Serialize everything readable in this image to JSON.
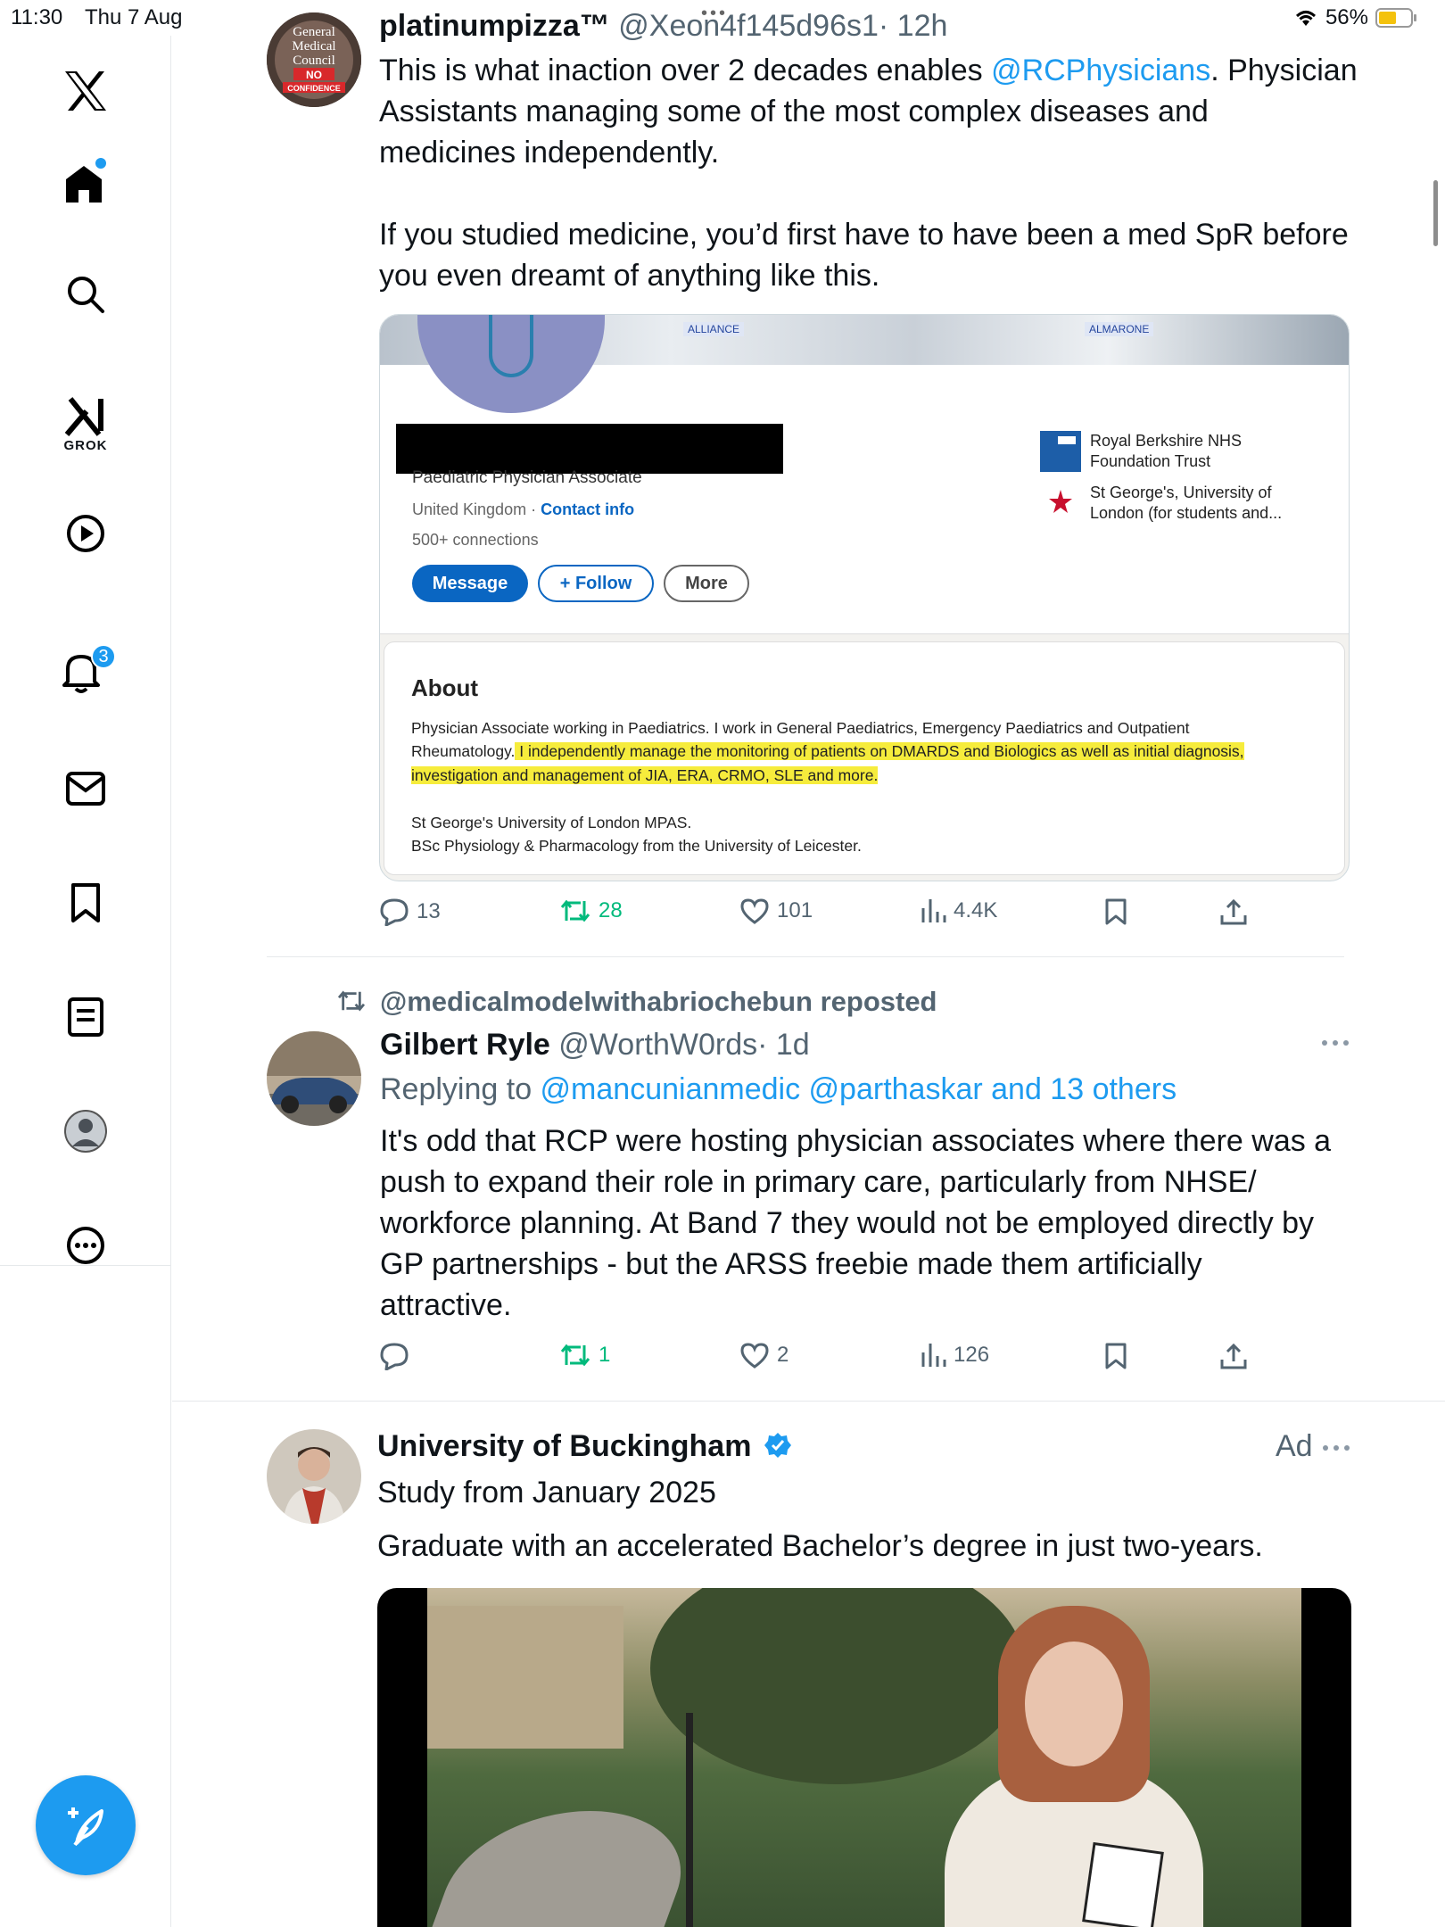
{
  "status_bar": {
    "time": "11:30",
    "date": "Thu 7 Aug",
    "battery_percent": "56%",
    "battery_level": 0.56
  },
  "sidebar": {
    "grok_label": "GROK",
    "notifications_badge": "3",
    "items": [
      "x-logo",
      "home",
      "search",
      "grok",
      "video",
      "notifications",
      "messages",
      "bookmarks",
      "lists",
      "profile",
      "more"
    ]
  },
  "tweet1": {
    "display_name": "platinumpizza™",
    "handle": "@Xeon4f145d96s1",
    "time": "· 12h",
    "text_part1": "This is what inaction over 2 decades enables ",
    "mention": "@RCPhysicians",
    "text_part2": ". Physician",
    "line2": "Assistants managing some of the most complex diseases and",
    "line3": "medicines independently.",
    "line4": "If you studied medicine, you’d first have to have been a med SpR before",
    "line5": "you even dreamt of anything like this.",
    "avatar_text": [
      "General",
      "Medical",
      "Council",
      "NO",
      "CONFIDENCE"
    ],
    "card": {
      "role": "Paediatric Physician Associate",
      "location": "United Kingdom · ",
      "contact": "Contact info",
      "connections": "500+ connections",
      "btn_message": "Message",
      "btn_follow": "+ Follow",
      "btn_more": "More",
      "org1_line1": "Royal Berkshire NHS",
      "org1_line2": "Foundation Trust",
      "org2_line1": "St George's, University of",
      "org2_line2": "London (for students and...",
      "banner_tag1": "ALLIANCE",
      "banner_tag2": "ALMARONE",
      "about_title": "About",
      "about_l1": "Physician Associate working in Paediatrics. I work in General Paediatrics, Emergency Paediatrics and Outpatient",
      "about_l2a": "Rheumatology.",
      "about_l2b": " I independently manage the monitoring of patients on DMARDS and Biologics as well as initial diagnosis,",
      "about_l3": "investigation and management of JIA, ERA, CRMO, SLE and more.",
      "about_l4": "St George's University of London MPAS.",
      "about_l5": "BSc Physiology & Pharmacology from the University of Leicester."
    },
    "actions": {
      "replies": "13",
      "reposts": "28",
      "likes": "101",
      "views": "4.4K"
    }
  },
  "tweet2": {
    "repost_label": "@medicalmodelwithabriochebun reposted",
    "display_name": "Gilbert Ryle",
    "handle": "@WorthW0rds",
    "time": "· 1d",
    "replying_prefix": "Replying to ",
    "replying_to": "@mancunianmedic @parthaskar and 13 others",
    "line1": "It's odd that RCP were hosting physician associates where there was a",
    "line2": "push to expand their role in primary care, particularly from NHSE/",
    "line3": "workforce planning. At Band 7 they would not be employed directly by",
    "line4": "GP partnerships - but the ARSS freebie made them artificially",
    "line5": "attractive.",
    "actions": {
      "replies": "",
      "reposts": "1",
      "likes": "2",
      "views": "126"
    }
  },
  "ad": {
    "display_name": "University of Buckingham",
    "ad_label": "Ad",
    "headline": "Study from January 2025",
    "body": "Graduate with an accelerated Bachelor’s degree in just two-years."
  },
  "colors": {
    "accent": "#1d9bf0",
    "repost_green": "#00ba7c",
    "muted": "#536471",
    "linkedin_blue": "#0a66c2",
    "highlight": "#f6ec3c"
  }
}
